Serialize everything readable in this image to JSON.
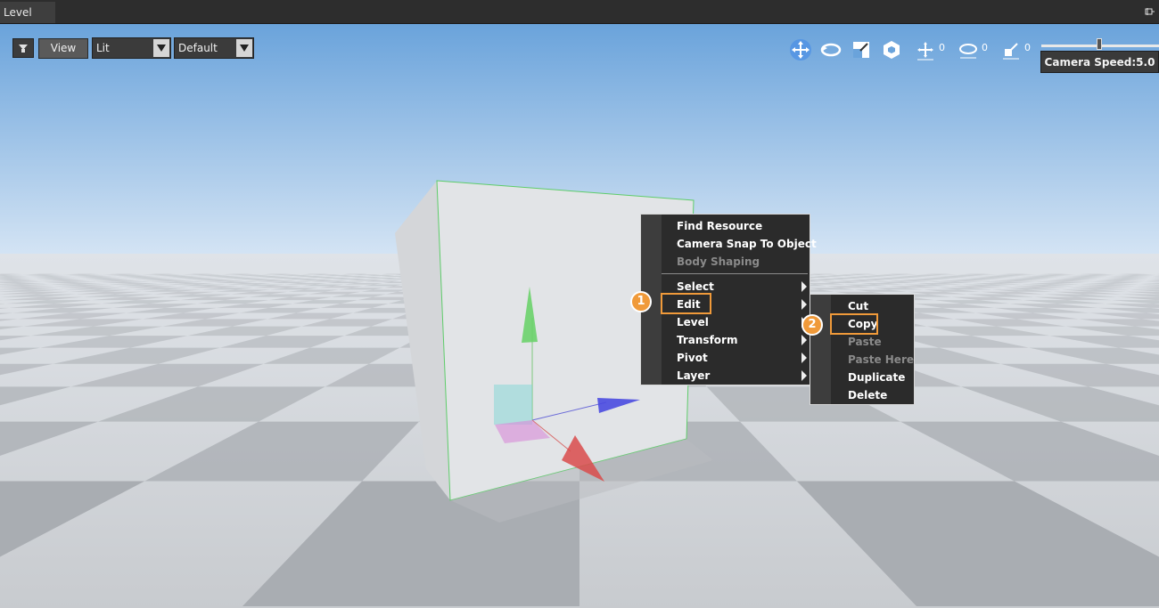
{
  "panel": {
    "tab_title": "Level",
    "pin_icon": "pin-icon"
  },
  "toolbar": {
    "view_label": "View",
    "render_mode": "Lit",
    "camera_preset": "Default",
    "gizmos": [
      {
        "name": "move-icon",
        "count": ""
      },
      {
        "name": "rotate-icon",
        "count": ""
      },
      {
        "name": "scale-icon",
        "count": ""
      },
      {
        "name": "local-space-icon",
        "count": ""
      },
      {
        "name": "translate-snap-icon",
        "count": "0"
      },
      {
        "name": "rotate-snap-icon",
        "count": "0"
      },
      {
        "name": "scale-snap-icon",
        "count": "0"
      }
    ],
    "camera_speed_label": "Camera Speed:5.0",
    "camera_speed_level": 0.5
  },
  "context_menu": {
    "items": [
      {
        "label": "Find Resource",
        "disabled": false,
        "submenu": false
      },
      {
        "label": "Camera Snap To Object",
        "disabled": false,
        "submenu": false
      },
      {
        "label": "Body Shaping",
        "disabled": true,
        "submenu": false
      },
      {
        "label": "Select",
        "disabled": false,
        "submenu": true
      },
      {
        "label": "Edit",
        "disabled": false,
        "submenu": true
      },
      {
        "label": "Level",
        "disabled": false,
        "submenu": true
      },
      {
        "label": "Transform",
        "disabled": false,
        "submenu": true
      },
      {
        "label": "Pivot",
        "disabled": false,
        "submenu": true
      },
      {
        "label": "Layer",
        "disabled": false,
        "submenu": true
      }
    ]
  },
  "edit_submenu": {
    "items": [
      {
        "label": "Cut",
        "disabled": false
      },
      {
        "label": "Copy",
        "disabled": false
      },
      {
        "label": "Paste",
        "disabled": true
      },
      {
        "label": "Paste Here",
        "disabled": true
      },
      {
        "label": "Duplicate",
        "disabled": false
      },
      {
        "label": "Delete",
        "disabled": false
      }
    ]
  },
  "annotations": {
    "step1": "1",
    "step2": "2"
  },
  "colors": {
    "accent": "#f09a3a",
    "sky_top": "#6fa6dc",
    "sky_bottom": "#cfe0f2"
  }
}
